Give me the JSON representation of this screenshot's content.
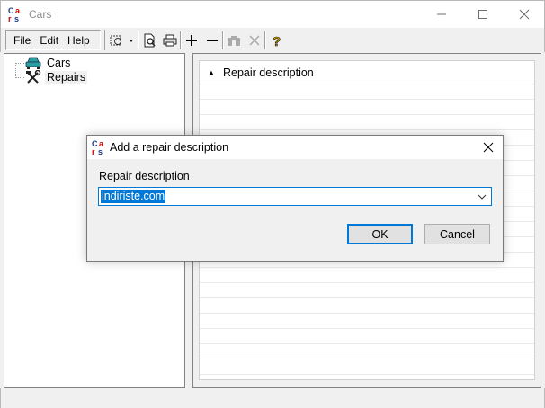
{
  "window": {
    "title": "Cars",
    "app_icon": "cars-app-icon",
    "controls": [
      "minimize-icon",
      "maximize-icon",
      "close-icon"
    ]
  },
  "menu": {
    "items": [
      {
        "label": "File"
      },
      {
        "label": "Edit"
      },
      {
        "label": "Help"
      }
    ]
  },
  "toolbar": {
    "icons": [
      "gear-dropdown-icon",
      "print-preview-icon",
      "print-icon",
      "add-icon",
      "remove-icon",
      "find-icon",
      "delete-icon",
      "help-icon"
    ]
  },
  "tree": {
    "items": [
      {
        "label": "Cars",
        "icon": "car-icon"
      },
      {
        "label": "Repairs",
        "icon": "tools-icon",
        "selected": true
      }
    ]
  },
  "grid": {
    "column_header": "Repair description",
    "sort": "ascending"
  },
  "dialog": {
    "title": "Add a repair description",
    "field_label": "Repair description",
    "field_value": "indiriste.com",
    "ok_label": "OK",
    "cancel_label": "Cancel"
  },
  "colors": {
    "accent": "#0078d7",
    "selection": "#0078d7"
  }
}
